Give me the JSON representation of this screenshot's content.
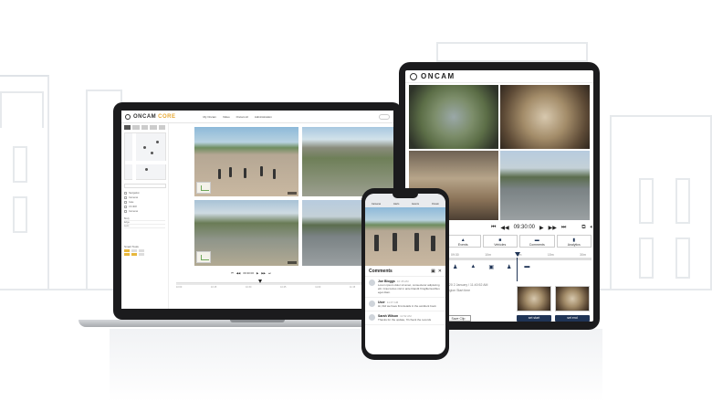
{
  "laptop": {
    "brand": "ONCAM",
    "brand_accent": "CORE",
    "nav": [
      "My Oncam",
      "Video",
      "Oncam AI",
      "Administration"
    ],
    "sidebar": {
      "filters": [
        "Navigation",
        "Cameras",
        "Gate",
        "CS 3D8",
        "Cameras"
      ],
      "fields": [
        "Body",
        "Edge",
        "Lens"
      ],
      "swatches_label": "Smart Tools"
    },
    "timeline": {
      "time": "09:30:00",
      "scale": [
        "10:00",
        "10:15",
        "10:30",
        "10:45",
        "11:00",
        "11:15",
        "11:30"
      ]
    }
  },
  "tablet": {
    "brand": "ONCAM",
    "time": "09:30:00",
    "tabs": [
      {
        "icon": "bell-icon",
        "label": "Events"
      },
      {
        "icon": "car-icon",
        "label": "Vehicles"
      },
      {
        "icon": "comment-icon",
        "label": "Comments"
      },
      {
        "icon": "chart-icon",
        "label": "Analytics"
      }
    ],
    "scale": [
      "09:30",
      "10m",
      "5m",
      "15m",
      "30m"
    ],
    "meta": [
      "2020 2 January / 11:40:52 AM",
      "Region Start time"
    ],
    "buttons": {
      "save_clip": "Save Clip",
      "set_start": "set start",
      "set_end": "set end"
    }
  },
  "phone": {
    "tabs": [
      "Cameras",
      "Alerts",
      "Events",
      "Oncam"
    ],
    "comments_title": "Comments",
    "comments": [
      {
        "name": "Joe Bloggs",
        "time": "10:45 AM",
        "text": "Lorem ipsum dolor sit amet, consectetur adipiscing elit. Cras luctus nisl in ante blandit fringilla faucibus eget diam."
      },
      {
        "name": "User",
        "time": "11:47 AM",
        "text": "Hi, Did we have first details in the accident book"
      },
      {
        "name": "Sarah Wilson",
        "time": "11:52 AM",
        "text": "Thanks for the update, I'll check the records"
      }
    ]
  },
  "colors": {
    "accent": "#e7a833",
    "navy": "#1f3456",
    "device": "#1b1b1d"
  }
}
